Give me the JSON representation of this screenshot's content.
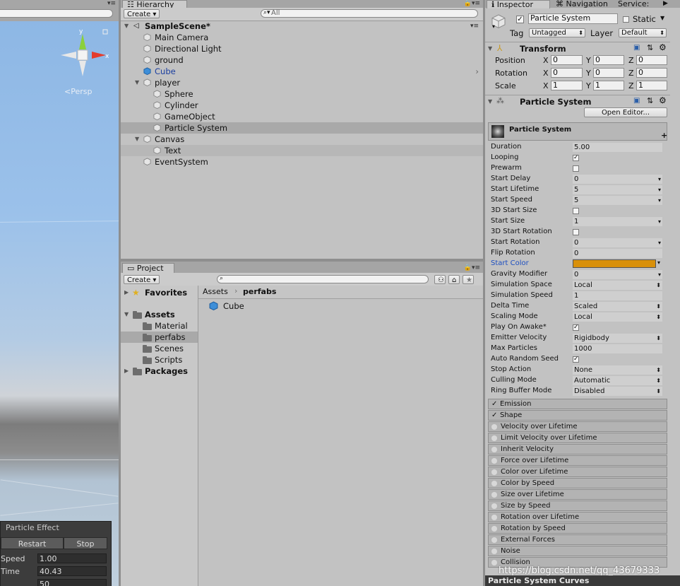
{
  "scene": {
    "gizmo_x": "x",
    "gizmo_y": "y",
    "persp_label": "<Persp",
    "particle_effect": {
      "title": "Particle Effect",
      "restart": "Restart",
      "stop": "Stop",
      "rows": [
        {
          "label": "Speed",
          "value": "1.00"
        },
        {
          "label": "Time",
          "value": "40.43"
        },
        {
          "label": "",
          "value": "50"
        }
      ]
    }
  },
  "hierarchy": {
    "tab": "Hierarchy",
    "create": "Create ▾",
    "search_placeholder": "All",
    "scene_name": "SampleScene*",
    "items": [
      {
        "label": "Main Camera"
      },
      {
        "label": "Directional Light"
      },
      {
        "label": "ground"
      },
      {
        "label": "Cube"
      },
      {
        "label": "player"
      },
      {
        "label": "Sphere"
      },
      {
        "label": "Cylinder"
      },
      {
        "label": "GameObject"
      },
      {
        "label": "Particle System"
      },
      {
        "label": "Canvas"
      },
      {
        "label": "Text"
      },
      {
        "label": "EventSystem"
      }
    ]
  },
  "project": {
    "tab": "Project",
    "create": "Create ▾",
    "tree": {
      "favorites": "Favorites",
      "assets": "Assets",
      "folders": [
        "Material",
        "perfabs",
        "Scenes",
        "Scripts"
      ],
      "packages": "Packages"
    },
    "breadcrumb": {
      "root": "Assets",
      "current": "perfabs"
    },
    "files": [
      "Cube"
    ]
  },
  "inspector": {
    "tabs": {
      "inspector": "Inspector",
      "navigation": "Navigation",
      "services": "Service:"
    },
    "object_name": "Particle System",
    "static_label": "Static",
    "tag_label": "Tag",
    "tag_value": "Untagged",
    "layer_label": "Layer",
    "layer_value": "Default",
    "transform": {
      "title": "Transform",
      "rows": [
        {
          "label": "Position",
          "x": "0",
          "y": "0",
          "z": "0"
        },
        {
          "label": "Rotation",
          "x": "0",
          "y": "0",
          "z": "0"
        },
        {
          "label": "Scale",
          "x": "1",
          "y": "1",
          "z": "1"
        }
      ],
      "axis_x": "X",
      "axis_y": "Y",
      "axis_z": "Z"
    },
    "particle": {
      "title": "Particle System",
      "open_editor": "Open Editor...",
      "module_title": "Particle System",
      "start_color": "#d8900a",
      "props": [
        {
          "label": "Duration",
          "value": "5.00",
          "kind": "text"
        },
        {
          "label": "Looping",
          "value": "✓",
          "kind": "check"
        },
        {
          "label": "Prewarm",
          "value": "",
          "kind": "check"
        },
        {
          "label": "Start Delay",
          "value": "0",
          "kind": "dd"
        },
        {
          "label": "Start Lifetime",
          "value": "5",
          "kind": "dd"
        },
        {
          "label": "Start Speed",
          "value": "5",
          "kind": "dd"
        },
        {
          "label": "3D Start Size",
          "value": "",
          "kind": "check"
        },
        {
          "label": "Start Size",
          "value": "1",
          "kind": "dd"
        },
        {
          "label": "3D Start Rotation",
          "value": "",
          "kind": "check"
        },
        {
          "label": "Start Rotation",
          "value": "0",
          "kind": "dd"
        },
        {
          "label": "Flip Rotation",
          "value": "0",
          "kind": "text"
        },
        {
          "label": "Start Color",
          "value": "",
          "kind": "color"
        },
        {
          "label": "Gravity Modifier",
          "value": "0",
          "kind": "dd"
        },
        {
          "label": "Simulation Space",
          "value": "Local",
          "kind": "ud"
        },
        {
          "label": "Simulation Speed",
          "value": "1",
          "kind": "text"
        },
        {
          "label": "Delta Time",
          "value": "Scaled",
          "kind": "ud"
        },
        {
          "label": "Scaling Mode",
          "value": "Local",
          "kind": "ud"
        },
        {
          "label": "Play On Awake*",
          "value": "✓",
          "kind": "check"
        },
        {
          "label": "Emitter Velocity",
          "value": "Rigidbody",
          "kind": "ud"
        },
        {
          "label": "Max Particles",
          "value": "1000",
          "kind": "text"
        },
        {
          "label": "Auto Random Seed",
          "value": "✓",
          "kind": "check"
        },
        {
          "label": "Stop Action",
          "value": "None",
          "kind": "ud"
        },
        {
          "label": "Culling Mode",
          "value": "Automatic",
          "kind": "ud"
        },
        {
          "label": "Ring Buffer Mode",
          "value": "Disabled",
          "kind": "ud"
        }
      ],
      "modules": [
        {
          "label": "Emission",
          "enabled": true
        },
        {
          "label": "Shape",
          "enabled": true
        },
        {
          "label": "Velocity over Lifetime",
          "enabled": false
        },
        {
          "label": "Limit Velocity over Lifetime",
          "enabled": false
        },
        {
          "label": "Inherit Velocity",
          "enabled": false
        },
        {
          "label": "Force over Lifetime",
          "enabled": false
        },
        {
          "label": "Color over Lifetime",
          "enabled": false
        },
        {
          "label": "Color by Speed",
          "enabled": false
        },
        {
          "label": "Size over Lifetime",
          "enabled": false
        },
        {
          "label": "Size by Speed",
          "enabled": false
        },
        {
          "label": "Rotation over Lifetime",
          "enabled": false
        },
        {
          "label": "Rotation by Speed",
          "enabled": false
        },
        {
          "label": "External Forces",
          "enabled": false
        },
        {
          "label": "Noise",
          "enabled": false
        },
        {
          "label": "Collision",
          "enabled": false
        }
      ]
    },
    "curves_bar": "Particle System Curves"
  },
  "watermark": "https://blog.csdn.net/qq_43679333"
}
